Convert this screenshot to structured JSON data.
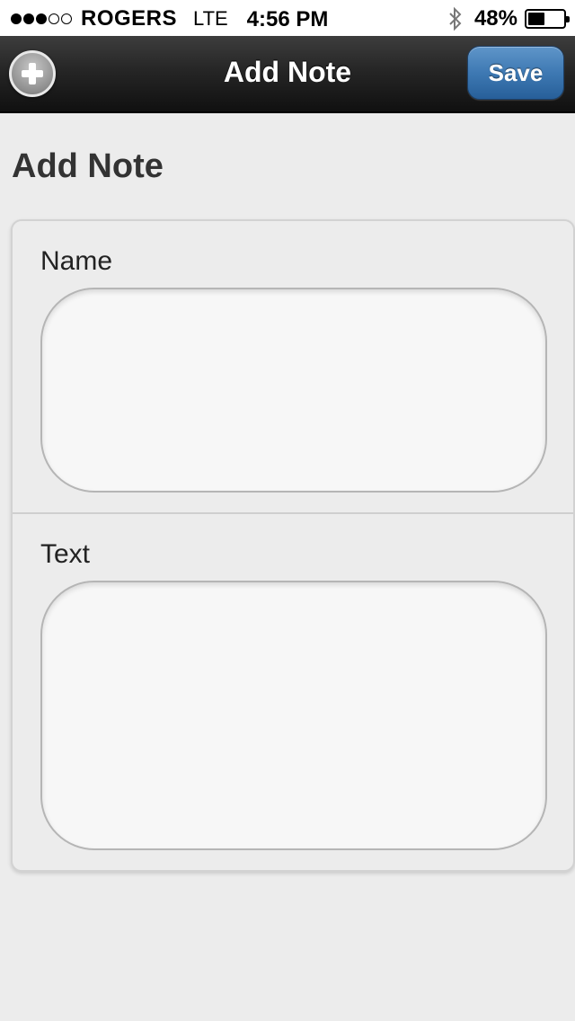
{
  "status_bar": {
    "carrier": "ROGERS",
    "network": "LTE",
    "time": "4:56 PM",
    "battery_percent": "48%",
    "battery_level": 0.48,
    "signal_bars_filled": 3,
    "signal_bars_total": 5
  },
  "nav": {
    "title": "Add Note",
    "save_label": "Save",
    "add_icon": "plus-circle-icon",
    "save_color": "#3e79b3"
  },
  "page": {
    "title": "Add Note"
  },
  "form": {
    "name": {
      "label": "Name",
      "value": "",
      "placeholder": ""
    },
    "text": {
      "label": "Text",
      "value": "",
      "placeholder": ""
    }
  }
}
